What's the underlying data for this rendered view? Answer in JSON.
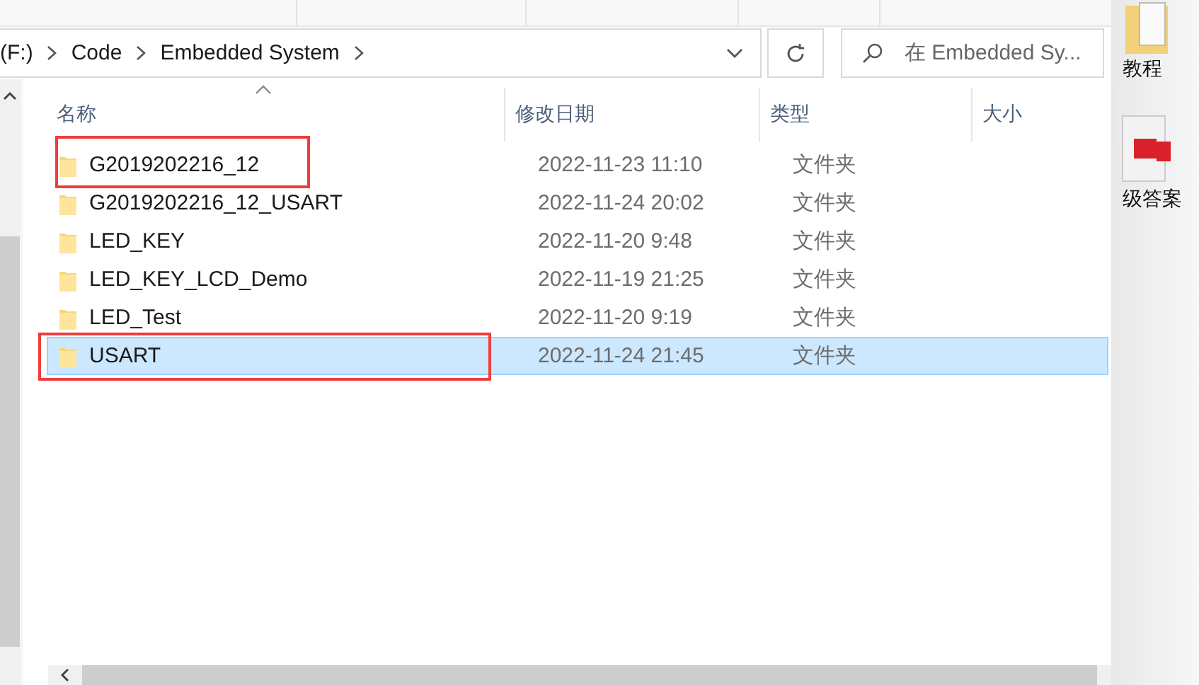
{
  "address_bar": {
    "path": [
      "(F:)",
      "Code",
      "Embedded System"
    ]
  },
  "search": {
    "placeholder": "在 Embedded Sy..."
  },
  "columns": [
    {
      "label": "名称",
      "sorted": true
    },
    {
      "label": "修改日期",
      "sorted": false
    },
    {
      "label": "类型",
      "sorted": false
    },
    {
      "label": "大小",
      "sorted": false
    }
  ],
  "rows": [
    {
      "name": "G2019202216_12",
      "modified": "2022-11-23 11:10",
      "type": "文件夹",
      "selected": false,
      "annotated": true
    },
    {
      "name": "G2019202216_12_USART",
      "modified": "2022-11-24 20:02",
      "type": "文件夹",
      "selected": false,
      "annotated": false
    },
    {
      "name": "LED_KEY",
      "modified": "2022-11-20 9:48",
      "type": "文件夹",
      "selected": false,
      "annotated": false
    },
    {
      "name": "LED_KEY_LCD_Demo",
      "modified": "2022-11-19 21:25",
      "type": "文件夹",
      "selected": false,
      "annotated": false
    },
    {
      "name": "LED_Test",
      "modified": "2022-11-20 9:19",
      "type": "文件夹",
      "selected": false,
      "annotated": false
    },
    {
      "name": "USART",
      "modified": "2022-11-24 21:45",
      "type": "文件夹",
      "selected": true,
      "annotated": true
    }
  ],
  "desktop_icons": [
    {
      "label": "教程",
      "kind": "folder"
    },
    {
      "label": "级答案",
      "kind": "pdf"
    }
  ]
}
